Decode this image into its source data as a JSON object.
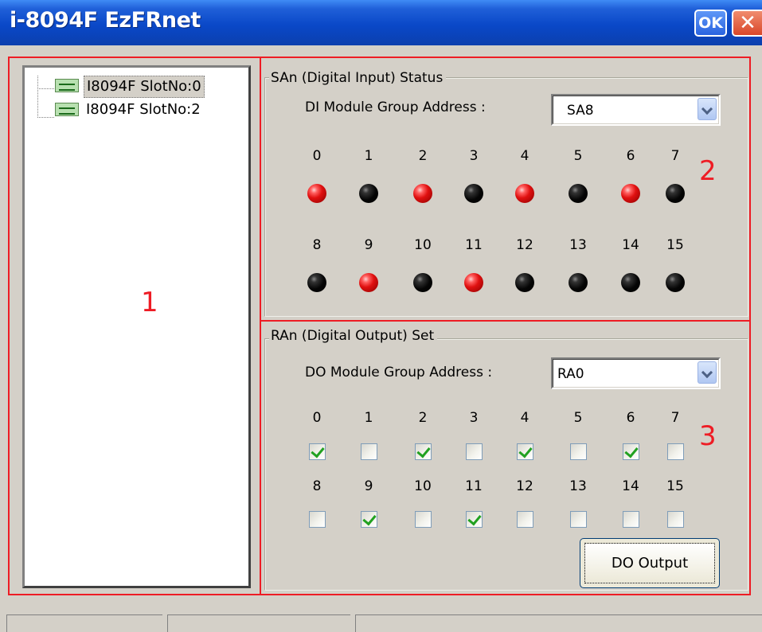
{
  "window": {
    "title": "i-8094F EzFRnet",
    "ok_label": "OK",
    "close_label": "✕"
  },
  "tree": {
    "items": [
      {
        "label": "I8094F SlotNo:0"
      },
      {
        "label": "I8094F SlotNo:2"
      }
    ]
  },
  "markers": {
    "one": "1",
    "two": "2",
    "three": "3"
  },
  "di_section": {
    "title": "SAn (Digital Input) Status",
    "address_label": "DI Module Group Address :",
    "address_value": "SA8",
    "channels": [
      "0",
      "1",
      "2",
      "3",
      "4",
      "5",
      "6",
      "7",
      "8",
      "9",
      "10",
      "11",
      "12",
      "13",
      "14",
      "15"
    ],
    "states": [
      true,
      false,
      true,
      false,
      true,
      false,
      true,
      false,
      false,
      true,
      false,
      true,
      false,
      false,
      false,
      false
    ]
  },
  "do_section": {
    "title": "RAn (Digital Output) Set",
    "address_label": "DO Module Group Address :",
    "address_value": "RA0",
    "channels": [
      "0",
      "1",
      "2",
      "3",
      "4",
      "5",
      "6",
      "7",
      "8",
      "9",
      "10",
      "11",
      "12",
      "13",
      "14",
      "15"
    ],
    "checked": [
      true,
      false,
      true,
      false,
      true,
      false,
      true,
      false,
      false,
      true,
      false,
      true,
      false,
      false,
      false,
      false
    ],
    "button_label": "DO Output"
  },
  "colors": {
    "annotation": "#ee1c24",
    "led_on": "#e01010",
    "led_off": "#000000",
    "check": "#21a121"
  }
}
